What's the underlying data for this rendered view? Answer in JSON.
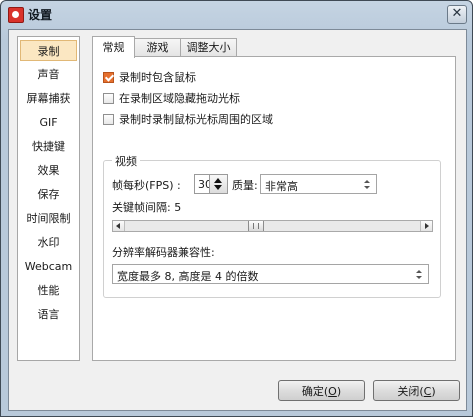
{
  "window": {
    "title": "设置",
    "close_glyph": "✕"
  },
  "sidebar": {
    "selected": "录制",
    "items": [
      "录制",
      "声音",
      "屏幕捕获",
      "GIF",
      "快捷键",
      "效果",
      "保存",
      "时间限制",
      "水印",
      "Webcam",
      "性能",
      "语言"
    ]
  },
  "tabs": [
    {
      "label": "常规",
      "active": true
    },
    {
      "label": "游戏",
      "active": false
    },
    {
      "label": "调整大小",
      "active": false
    }
  ],
  "options": [
    {
      "label": "录制时包含鼠标",
      "checked": true
    },
    {
      "label": "在录制区域隐藏拖动光标",
      "checked": false
    },
    {
      "label": "录制时录制鼠标光标周围的区域",
      "checked": false
    }
  ],
  "video": {
    "group_title": "视频",
    "fps_label": "帧每秒(FPS) :",
    "fps_value": "30",
    "quality_label": "质量:",
    "quality_value": "非常高",
    "keyframe_label": "关键帧间隔:",
    "keyframe_value": "5",
    "keyframe_slider_fraction": 0.44,
    "codec_label": "分辨率解码器兼容性:",
    "codec_value": "宽度最多 8, 高度是 4 的倍数"
  },
  "buttons": {
    "ok": {
      "label": "确定",
      "mnemonic": "O"
    },
    "close": {
      "label": "关闭",
      "mnemonic": "C"
    }
  },
  "colors": {
    "accent_checkbox": "#e6702e",
    "selected_sidebar": "#fbe7c2"
  },
  "icons": {
    "app": "app-record-icon",
    "close": "close-icon",
    "spin": "spinner-arrows-icon",
    "select": "dropdown-arrows-icon"
  }
}
